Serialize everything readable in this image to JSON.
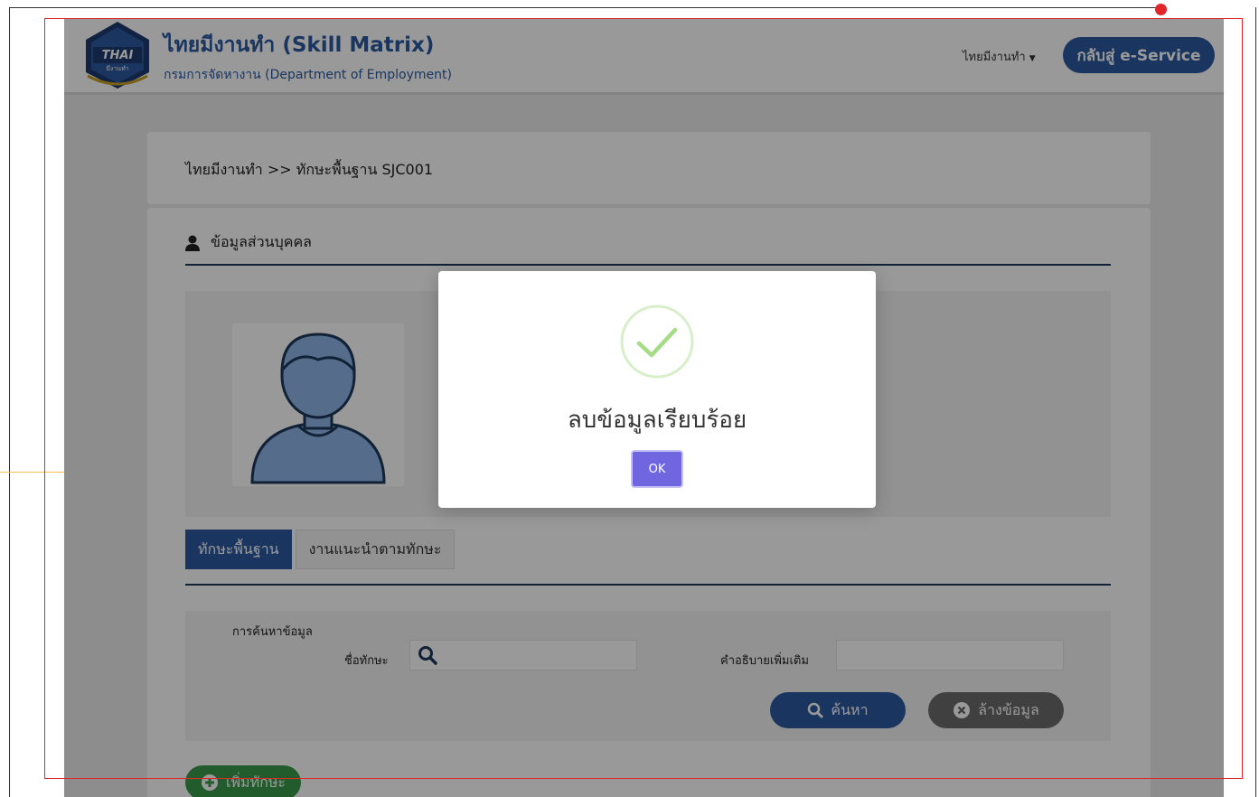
{
  "header": {
    "logo_text": "THAI",
    "logo_sub": "มีงานทำ",
    "title": "ไทยมีงานทำ (Skill Matrix)",
    "subtitle": "กรมการจัดหางาน (Department of Employment)",
    "nav_menu": "ไทยมีงานทำ",
    "eservice_button": "กลับสู่ e-Service"
  },
  "breadcrumb": "ไทยมีงานทำ >> ทักษะพื้นฐาน SJC001",
  "profile": {
    "section_title": "ข้อมูลส่วนบุคคล"
  },
  "tabs": [
    {
      "label": "ทักษะพื้นฐาน",
      "active": true
    },
    {
      "label": "งานแนะนำตามทักษะ",
      "active": false
    }
  ],
  "search": {
    "caption": "การค้นหาข้อมูล",
    "skill_label": "ชื่อทักษะ",
    "skill_value": "",
    "desc_label": "คำอธิบายเพิ่มเติม",
    "desc_value": "",
    "search_button": "ค้นหา",
    "clear_button": "ล้างข้อมูล"
  },
  "add_button": "เพิ่มทักษะ",
  "modal": {
    "message": "ลบข้อมูลเรียบร้อย",
    "ok_label": "OK"
  },
  "colors": {
    "primary": "#2c5aa0",
    "annotation": "#e0262b",
    "modal_ok": "#7066e0",
    "success": "#a5dc86",
    "add": "#3a9a4a"
  }
}
